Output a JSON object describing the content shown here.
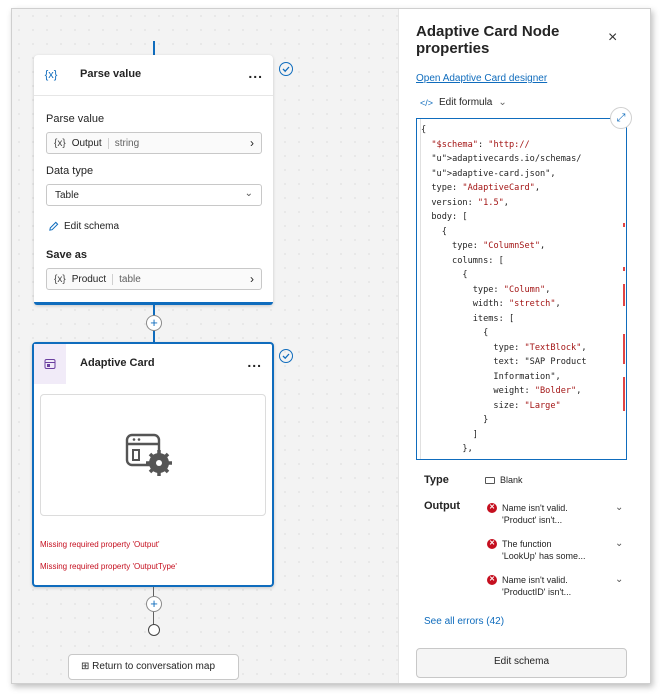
{
  "canvas": {
    "parse_node": {
      "title": "Parse value",
      "icon": "variable-braces-icon",
      "icon_text": "{x}",
      "more": "...",
      "parse_label": "Parse value",
      "parse_var": "{x}",
      "parse_var_name": "Output",
      "parse_var_type": "string",
      "data_type_label": "Data type",
      "data_type_value": "Table",
      "edit_schema_label": "Edit schema",
      "save_as_label": "Save as",
      "save_var": "{x}",
      "save_var_name": "Product",
      "save_var_type": "table"
    },
    "card_node": {
      "title": "Adaptive Card",
      "icon": "adaptive-card-icon",
      "more": "...",
      "errors": [
        "Missing required property 'Output'",
        "Missing required property 'OutputType'"
      ]
    },
    "plus_label": "+",
    "return_button": "Return to conversation map"
  },
  "panel": {
    "title": "Adaptive Card Node properties",
    "close": "×",
    "designer_link": "Open Adaptive Card designer",
    "formula_label": "Edit formula",
    "code_lines": [
      "{",
      "  \"$schema\": \"http://",
      "  adaptivecards.io/schemas/",
      "  adaptive-card.json\",",
      "  type: \"AdaptiveCard\",",
      "  version: \"1.5\",",
      "  body: [",
      "    {",
      "      type: \"ColumnSet\",",
      "      columns: [",
      "        {",
      "          type: \"Column\",",
      "          width: \"stretch\",",
      "          items: [",
      "            {",
      "              type: \"TextBlock\",",
      "              text: \"SAP Product",
      "              Information\",",
      "              weight: \"Bolder\",",
      "              size: \"Large\"",
      "            }",
      "          ]",
      "        },",
      "        {"
    ],
    "type_label": "Type",
    "type_value": "Blank",
    "output_label": "Output",
    "output_errors": [
      {
        "line1": "Name isn't valid.",
        "line2": "'Product' isn't..."
      },
      {
        "line1": "The function",
        "line2": "'LookUp' has some..."
      },
      {
        "line1": "Name isn't valid.",
        "line2": "'ProductID' isn't..."
      }
    ],
    "see_all": "See all errors (42)",
    "edit_schema_button": "Edit schema"
  }
}
